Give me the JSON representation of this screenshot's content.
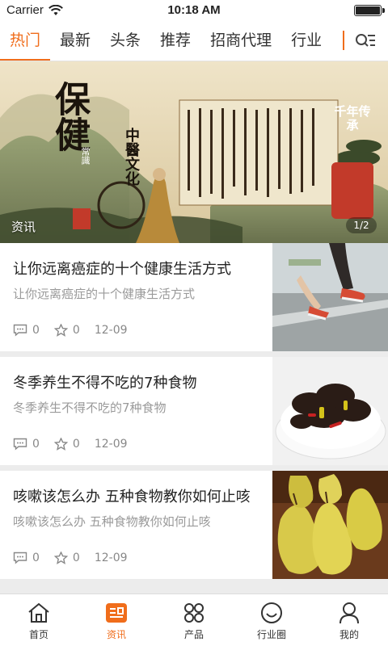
{
  "status": {
    "carrier": "Carrier",
    "time": "10:18 AM"
  },
  "tabs": [
    {
      "label": "热门",
      "active": true
    },
    {
      "label": "最新"
    },
    {
      "label": "头条"
    },
    {
      "label": "推荐"
    },
    {
      "label": "招商代理"
    },
    {
      "label": "行业"
    }
  ],
  "banner": {
    "big_title": "保健",
    "circle_text": "中醫文化",
    "seal_text": "常識",
    "right_title": "千年传承",
    "tag": "资讯",
    "pager": "1/2"
  },
  "news": [
    {
      "title": "让你远离癌症的十个健康生活方式",
      "summary": "让你远离癌症的十个健康生活方式",
      "comments": "0",
      "stars": "0",
      "date": "12-09"
    },
    {
      "title": "冬季养生不得不吃的7种食物",
      "summary": "冬季养生不得不吃的7种食物",
      "comments": "0",
      "stars": "0",
      "date": "12-09"
    },
    {
      "title": "咳嗽该怎么办 五种食物教你如何止咳",
      "summary": "咳嗽该怎么办 五种食物教你如何止咳",
      "comments": "0",
      "stars": "0",
      "date": "12-09"
    }
  ],
  "nav": [
    {
      "label": "首页",
      "icon": "home-icon"
    },
    {
      "label": "资讯",
      "icon": "news-icon",
      "active": true
    },
    {
      "label": "产品",
      "icon": "grid-icon"
    },
    {
      "label": "行业圈",
      "icon": "smile-icon"
    },
    {
      "label": "我的",
      "icon": "user-icon"
    }
  ],
  "colors": {
    "accent": "#f06d1b"
  }
}
